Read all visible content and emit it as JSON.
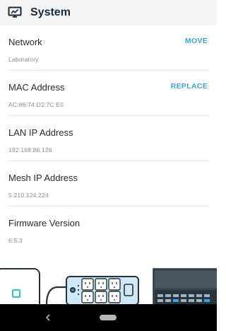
{
  "header": {
    "title": "System",
    "icon": "monitor-icon"
  },
  "rows": [
    {
      "label": "Network",
      "value": "Laboratory",
      "action": "MOVE"
    },
    {
      "label": "MAC Address",
      "value": "AC:86:74:D2:7C:E0",
      "action": "REPLACE"
    },
    {
      "label": "LAN IP Address",
      "value": "192.168.86.126"
    },
    {
      "label": "Mesh IP Address",
      "value": "5.210.124.224"
    },
    {
      "label": "Firmware Version",
      "value": "6.5.3"
    }
  ],
  "colors": {
    "accent": "#3aa6dc",
    "header_bg": "#f4f5f6",
    "title_text": "#1b2a36",
    "value_text": "#7d8f9c",
    "device_outline": "#263238",
    "device_fill": "#cfe8f5",
    "navbar": "#000000"
  },
  "navbar": {
    "back_icon": "back-triangle-icon",
    "home_icon": "home-pill-icon"
  }
}
